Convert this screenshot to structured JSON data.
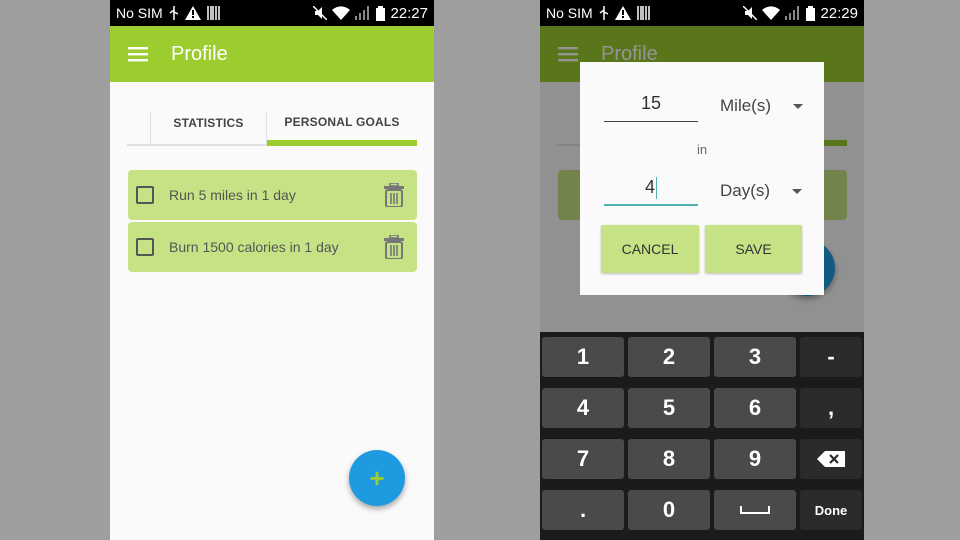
{
  "left": {
    "status": {
      "carrier": "No SIM",
      "time": "22:27"
    },
    "appbar": {
      "title": "Profile"
    },
    "tabs": [
      {
        "label": "STATISTICS"
      },
      {
        "label": "PERSONAL GOALS"
      }
    ],
    "goals": [
      {
        "text": "Run 5 miles in 1 day"
      },
      {
        "text": "Burn 1500 calories in 1 day"
      }
    ],
    "fab": {
      "label": "+"
    }
  },
  "right": {
    "status": {
      "carrier": "No SIM",
      "time": "22:29"
    },
    "appbar": {
      "title": "Profile"
    },
    "dialog": {
      "distance_value": "15",
      "distance_unit": "Mile(s)",
      "connector": "in",
      "time_value": "4",
      "time_unit": "Day(s)",
      "cancel_label": "CANCEL",
      "save_label": "SAVE"
    },
    "keyboard": {
      "rows": [
        [
          "1",
          "2",
          "3",
          "-"
        ],
        [
          "4",
          "5",
          "6",
          ","
        ],
        [
          "7",
          "8",
          "9",
          "backspace-icon"
        ],
        [
          ".",
          "0",
          "space-icon",
          "Done"
        ]
      ]
    }
  },
  "colors": {
    "accent": "#9ccc2e",
    "goal_bg": "#c5e384",
    "fab": "#1e9be0"
  }
}
